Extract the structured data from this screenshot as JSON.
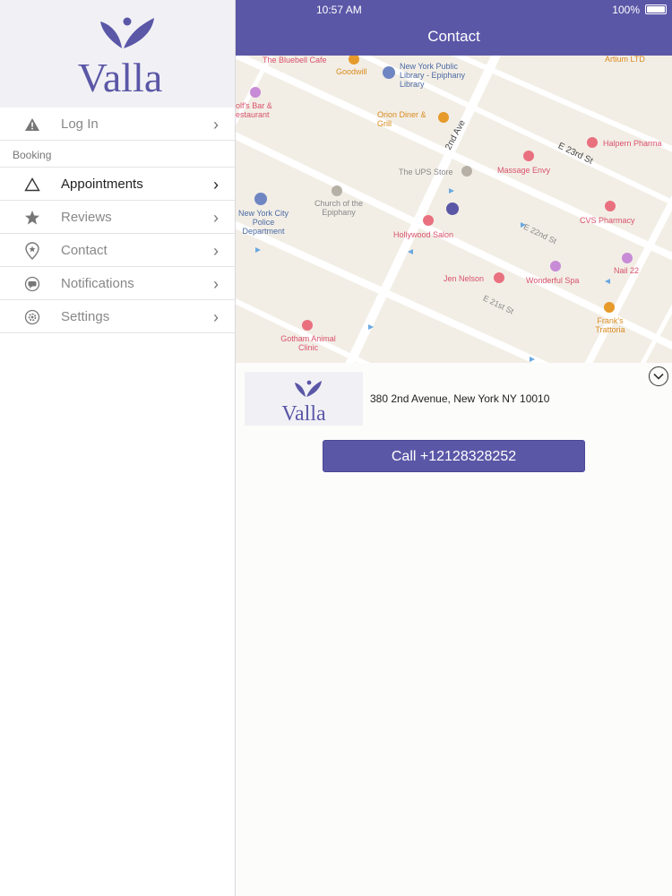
{
  "status_bar": {
    "time": "10:57 AM",
    "battery": "100%"
  },
  "nav": {
    "title": "Contact"
  },
  "brand": {
    "logo_text": "Valla",
    "accent": "#5b57a7"
  },
  "sidebar": {
    "login": {
      "label": "Log In",
      "icon": "warning-icon"
    },
    "section": "Booking",
    "items": [
      {
        "label": "Appointments",
        "icon": "triangle-icon",
        "active": true
      },
      {
        "label": "Reviews",
        "icon": "star-icon"
      },
      {
        "label": "Contact",
        "icon": "location-pin-icon"
      },
      {
        "label": "Notifications",
        "icon": "chat-bubble-icon"
      },
      {
        "label": "Settings",
        "icon": "gear-icon"
      }
    ]
  },
  "map": {
    "streets": [
      "2nd Ave",
      "E 23rd St",
      "E 22nd St",
      "E 21st St"
    ],
    "places": [
      "The Bluebell Cafe",
      "Goodwill",
      "New York Public Library - Epiphany Library",
      "Artium LTD",
      "olf's Bar & estaurant",
      "Orion Diner & Grill",
      "Halpern Pharma",
      "Massage Envy",
      "The UPS Store",
      "Church of the Epiphany",
      "New York City Police Department",
      "CVS Pharmacy",
      "Hollywood Salon",
      "Jen Nelson",
      "Wonderful Spa",
      "Nail 22",
      "Frank's Trattoria",
      "Gotham Animal Clinic"
    ]
  },
  "contact": {
    "address": "380 2nd Avenue, New York NY 10010",
    "call_label": "Call +12128328252"
  }
}
